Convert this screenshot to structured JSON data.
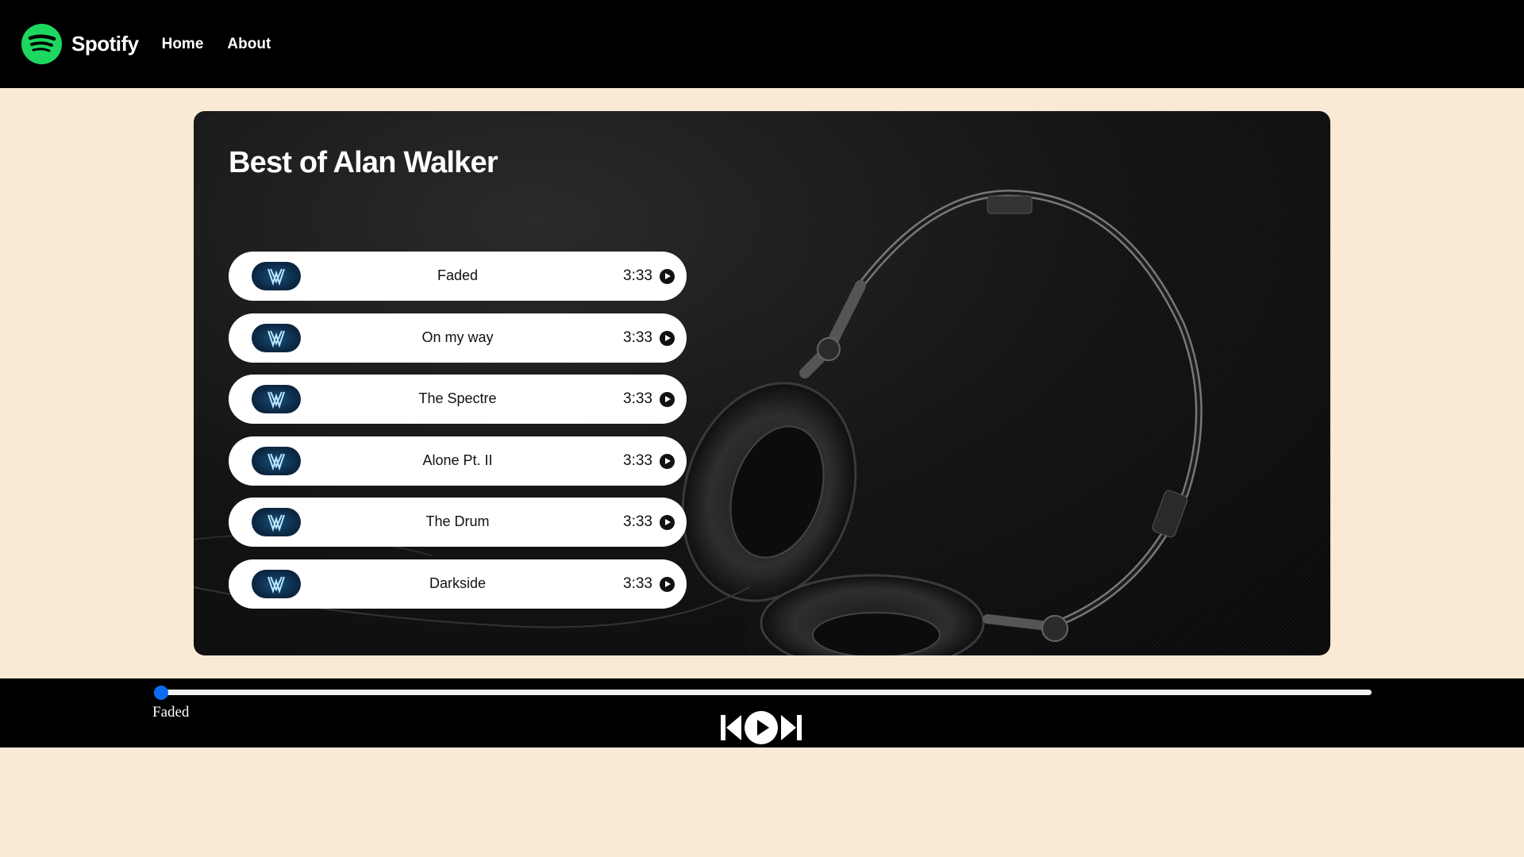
{
  "nav": {
    "brand": "Spotify",
    "links": [
      "Home",
      "About"
    ]
  },
  "playlist": {
    "title": "Best of Alan Walker",
    "songs": [
      {
        "name": "Faded",
        "duration": "3:33"
      },
      {
        "name": "On my way",
        "duration": "3:33"
      },
      {
        "name": "The Spectre",
        "duration": "3:33"
      },
      {
        "name": "Alone Pt. II",
        "duration": "3:33"
      },
      {
        "name": "The Drum",
        "duration": "3:33"
      },
      {
        "name": "Darkside",
        "duration": "3:33"
      }
    ]
  },
  "player": {
    "current_song": "Faded",
    "progress_fraction": 0.0
  },
  "colors": {
    "accent": "#1ed760",
    "page_background": "#fae9d5",
    "progress_accent": "#0b6cf2"
  },
  "icons": {
    "logo": "spotify-logo-icon",
    "song_cover": "alan-walker-logo-icon",
    "song_play": "play-circle-icon",
    "prev": "skip-previous-icon",
    "play": "play-circle-icon",
    "next": "skip-next-icon"
  }
}
